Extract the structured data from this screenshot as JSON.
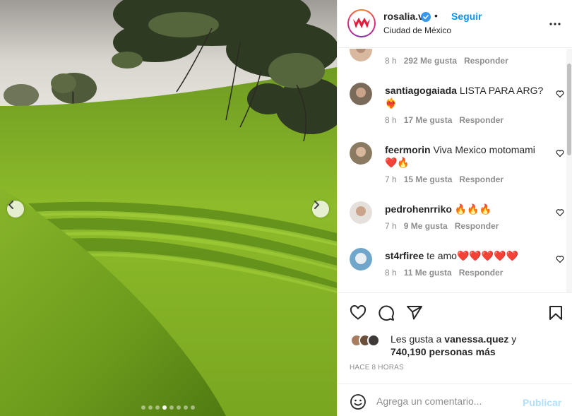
{
  "post": {
    "username": "rosalia.vt",
    "follow_label": "Seguir",
    "separator": "•",
    "location": "Ciudad de México",
    "more_icon": "more-horizontal-icon",
    "carousel": {
      "total_slides": 8,
      "active_slide": 4
    }
  },
  "comments": [
    {
      "username": "",
      "text": "",
      "time": "8 h",
      "likes": "292 Me gusta",
      "reply": "Responder",
      "avatar_color": "#d9b8a0"
    },
    {
      "username": "santiagogaiada",
      "text": "LISTA PARA ARG? ❤️‍🔥",
      "time": "8 h",
      "likes": "17 Me gusta",
      "reply": "Responder",
      "avatar_color": "#7a6a5a"
    },
    {
      "username": "feermorin",
      "text": "Viva Mexico motomami ❤️🔥",
      "time": "7 h",
      "likes": "15 Me gusta",
      "reply": "Responder",
      "avatar_color": "#8b7a62"
    },
    {
      "username": "pedrohenrriko",
      "text": "🔥🔥🔥",
      "time": "7 h",
      "likes": "9 Me gusta",
      "reply": "Responder",
      "avatar_color": "#c9c3bd"
    },
    {
      "username": "st4rfiree",
      "text": "te amo❤️❤️❤️❤️❤️",
      "time": "8 h",
      "likes": "11 Me gusta",
      "reply": "Responder",
      "avatar_color": "#6fa6c9"
    }
  ],
  "actions": {
    "like_icon": "heart-icon",
    "comment_icon": "comment-icon",
    "share_icon": "send-icon",
    "save_icon": "bookmark-icon"
  },
  "likes": {
    "prefix": "Les gusta a",
    "user": "vanessa.quez",
    "conjunction": "y",
    "others": "740,190 personas más",
    "avatar_colors": [
      "#a87c5f",
      "#6b4f3a",
      "#3f3a38"
    ]
  },
  "time_ago": "HACE 8 HORAS",
  "composer": {
    "placeholder": "Agrega un comentario...",
    "publish_label": "Publicar"
  },
  "colors": {
    "accent": "#0095f6",
    "publish_disabled": "#b2dffc",
    "secondary_text": "#8e8e8e",
    "heart_red": "#ed4956"
  }
}
